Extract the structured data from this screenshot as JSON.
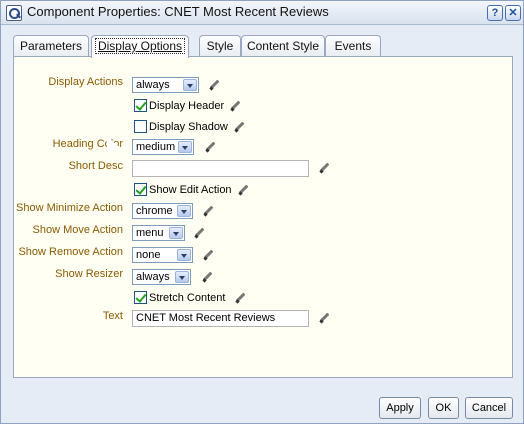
{
  "window": {
    "title": "Component Properties: CNET Most Recent Reviews",
    "help_label": "?",
    "close_label": "✕"
  },
  "tabs": [
    {
      "label": "Parameters"
    },
    {
      "label": "Display Options"
    },
    {
      "label": "Style"
    },
    {
      "label": "Content Style"
    },
    {
      "label": "Events"
    }
  ],
  "fields": {
    "display_actions": {
      "label": "Display Actions",
      "value": "always"
    },
    "display_header": {
      "label": "Display Header",
      "checked": true
    },
    "display_shadow": {
      "label": "Display Shadow",
      "checked": false
    },
    "heading_color": {
      "label": "Heading Color",
      "value": "medium"
    },
    "short_desc": {
      "label": "Short Desc",
      "value": ""
    },
    "show_edit_action": {
      "label": "Show Edit Action",
      "checked": true
    },
    "show_minimize_action": {
      "label": "Show Minimize Action",
      "value": "chrome"
    },
    "show_move_action": {
      "label": "Show Move Action",
      "value": "menu"
    },
    "show_remove_action": {
      "label": "Show Remove Action",
      "value": "none"
    },
    "show_resizer": {
      "label": "Show Resizer",
      "value": "always"
    },
    "stretch_content": {
      "label": "Stretch Content",
      "checked": true
    },
    "text": {
      "label": "Text",
      "value": "CNET Most Recent Reviews"
    }
  },
  "buttons": {
    "apply": "Apply",
    "ok": "OK",
    "cancel": "Cancel"
  }
}
